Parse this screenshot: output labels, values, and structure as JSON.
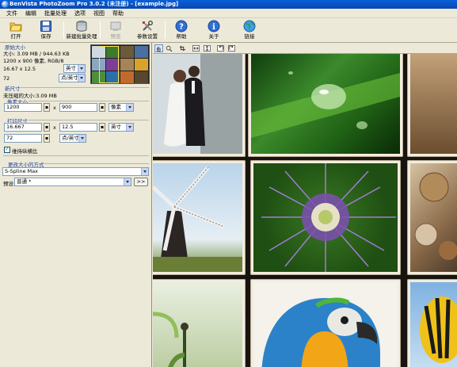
{
  "window": {
    "title": "BenVista PhotoZoom Pro 3.0.2 (未注册) - [example.jpg]"
  },
  "menu": [
    "文件",
    "编辑",
    "批量处理",
    "选项",
    "视图",
    "帮助"
  ],
  "toolbar": {
    "open": "打开",
    "save": "保存",
    "new_batch": "新建批量处理",
    "preview": "预览",
    "settings": "参数设置",
    "help": "帮助",
    "about": "关于",
    "link": "链接"
  },
  "original_size": {
    "title": "原始大小",
    "file_size": "大小: 3.09 MB / 944.63 KB",
    "dimensions": "1200 x 900 像素, RGB/8",
    "print_size": "16.67 x 12.5",
    "print_unit": "英寸",
    "resolution": "72",
    "resolution_unit": "点/英寸"
  },
  "new_size": {
    "title": "新尺寸",
    "uncompressed": "未压缩的大小:3.09 MB",
    "pixel_title": "像素大小",
    "width_px": "1200",
    "height_px": "900",
    "pixel_unit": "像素",
    "print_title": "打印尺寸",
    "width_in": "16.667",
    "height_in": "12.5",
    "print_unit": "英寸",
    "resolution": "72",
    "resolution_unit": "点/英寸",
    "times": "x",
    "keep_ratio_label": "维持纵横比",
    "keep_ratio_checked": true
  },
  "resize_method": {
    "title": "更改大小的方式",
    "method": "S-Spline Max",
    "preset_label": "预设:",
    "preset": "普通 *",
    "more_button": ">>"
  }
}
